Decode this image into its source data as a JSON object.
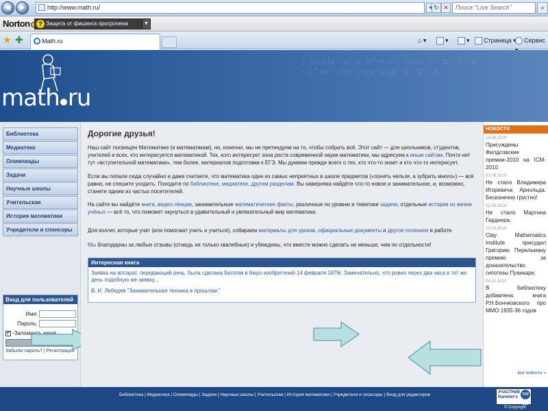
{
  "browser": {
    "url": "http://www.math.ru/",
    "search_placeholder": "Поиск \"Live Search\"",
    "norton": {
      "logo": "Norton",
      "phishing_status": "Защита от фишинга просрочена"
    },
    "tab_title": "Math.ru",
    "tools": {
      "page": "Страница",
      "service": "Сервис"
    }
  },
  "site": {
    "logo_text": "math",
    "logo_suffix": "ru",
    "menu": [
      "Библиотека",
      "Медиатека",
      "Олимпиады",
      "Задачи",
      "Научные школы",
      "Учительская",
      "История математики",
      "Учредители и спонсоры"
    ],
    "login": {
      "title": "Вход для пользователей",
      "name_label": "Имя:",
      "password_label": "Пароль:",
      "remember": "-Запомнить меня",
      "submit": "Вход",
      "forgot": "Забыли пароль?",
      "separator": "|",
      "register": "Регистрация"
    },
    "main": {
      "heading": "Дорогие друзья!",
      "p1": "Наш сайт посвящён Математике (и математикам), но, конечно, мы не претендуем на то, чтобы собрать всё. Этот сайт — для школьников, студентов, учителей и всех, кто интересуется математикой. Тех, кого интересует зона роста современной науки математики, мы адресуем к",
      "p1_link": "иным сайтам",
      "p1_end": ". Почти нет тут «вступительной математики», тем более, материалов подготовки к ЕГЭ. Мы думаем прежде всего о тех, кто что-то знает и кто что-то интересует.",
      "p2_start": "Если вы попали сюда случайно и даже считаете, что математика один из самых неприятных в школе предметов («понять нельзя, а зубрить много») — всё равно, не спешите уходить. Походите по",
      "p2_link1": "библиотеке",
      "p2_link2": "медиатеке",
      "p2_link3": "другим разделам",
      "p2_end": ". Вы наверняка найдёте что-то новое и занимательное, и, возможно, станете одним из частых посетителей.",
      "p3_start": "На сайте вы найдёте",
      "p3_link1": "книги",
      "p3_link2": "видео-лекции",
      "p3_mid1": ", занимательные",
      "p3_link3": "математические факты",
      "p3_mid2": ", различные по уровню и тематике",
      "p3_link4": "задачи",
      "p3_mid3": ", отдельные",
      "p3_link5": "истории из жизни учёных",
      "p3_end": " — всё то, что поможет окунуться в удивительный и увлекательный мир математики.",
      "p4_start": "Для коллег, которые учат (или помогают учить и учиться), собираем",
      "p4_link1": "материалы для уроков",
      "p4_link2": "официальные документы",
      "p4_mid": " и",
      "p4_link3": "другое полезное",
      "p4_end": " в работе.",
      "p5_link": "Мы",
      "p5_text": " благодарны за любые отзывы (отнюдь не только хвалебные) и убеждены, что вместе можно сделать не меньше, чем по отдельности!"
    },
    "book": {
      "title": "Интересная книга",
      "text": "Заявка на аппарат, передающий речь, была сделана Беллом в бюро изобретений 14 февраля 1876г. Замечательно, что ровно через два часа в тот же день подобную же заявку...",
      "author": "В. И. Лебедев \"Занимательная техника в прошлом.\""
    },
    "news": {
      "title": "НОВОСТИ",
      "items": [
        {
          "date": "19.08.2010",
          "text": "Присуждены Филдсовские премии-2010 на ICM-2010."
        },
        {
          "date": "03.06.2010",
          "text": "Не стало Владимира Игоревича Арнольда. Бесконечно грустно!"
        },
        {
          "date": "22.05.2010",
          "text": "Не стало Мартина Гарднера."
        },
        {
          "date": "19.03.2010",
          "text": "Clay Mathematics Institute присудил Григорию Перельману премию за доказательство гипотезы Пуанкаре."
        },
        {
          "date": "04.02.2010",
          "text": "В библиотеку добавлена книга Р.Н.Бончковского про ММО 1935-36 годов"
        }
      ],
      "all_link": "все новости »"
    },
    "footer": {
      "links": "Библиотека | Медиатека | Олимпиады | Задачи | Научные школы | Учительская | История математики | Учредители и спонсоры | Вход для редакторов",
      "badge_line1": "УЧАСТНИК",
      "badge_line2": "Rambler's",
      "badge_top": "TOP 100",
      "copyright": "© Copyright"
    }
  }
}
